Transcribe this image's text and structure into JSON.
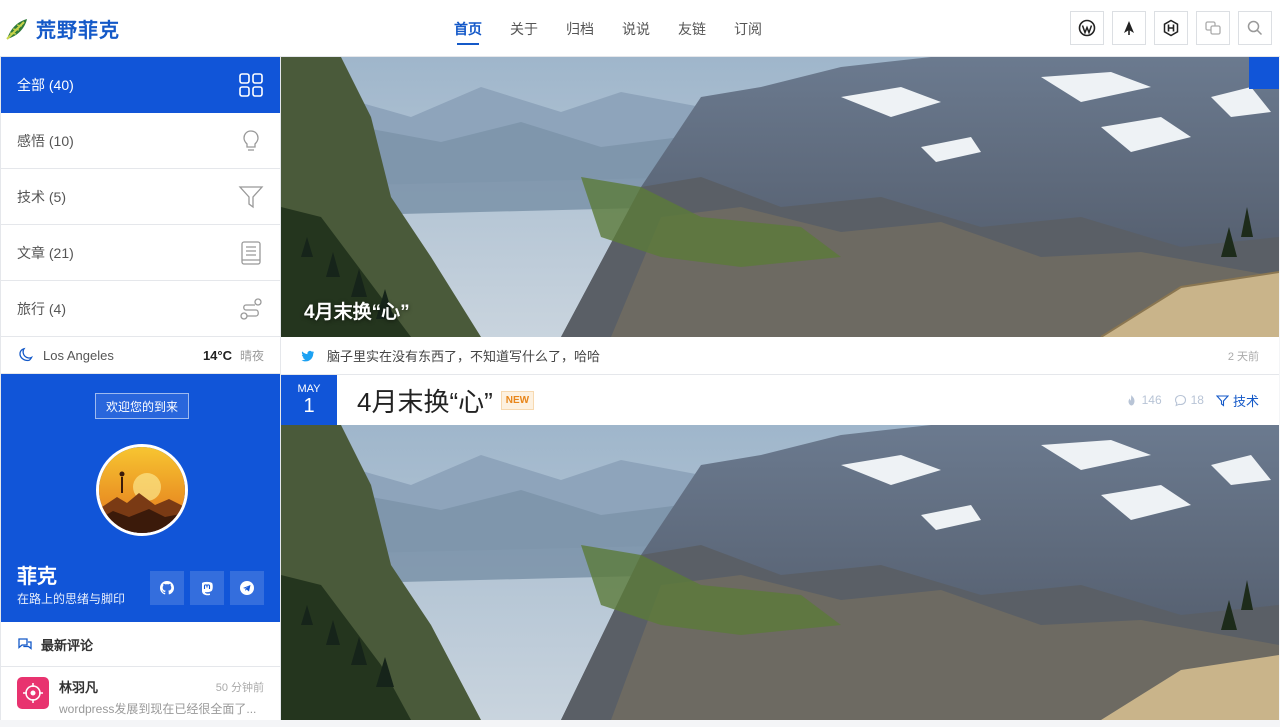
{
  "brand": {
    "name": "荒野菲克"
  },
  "nav": {
    "items": [
      {
        "label": "首页",
        "active": true
      },
      {
        "label": "关于",
        "active": false
      },
      {
        "label": "归档",
        "active": false
      },
      {
        "label": "说说",
        "active": false
      },
      {
        "label": "友链",
        "active": false
      },
      {
        "label": "订阅",
        "active": false
      }
    ]
  },
  "header_icons": [
    "wordpress-icon",
    "feather-icon",
    "hexo-icon",
    "translate-icon",
    "search-icon"
  ],
  "sidebar": {
    "categories": [
      {
        "label": "全部",
        "count": "(40)",
        "icon": "grid-icon",
        "active": true
      },
      {
        "label": "感悟",
        "count": "(10)",
        "icon": "lightbulb-icon",
        "active": false
      },
      {
        "label": "技术",
        "count": "(5)",
        "icon": "filter-icon",
        "active": false
      },
      {
        "label": "文章",
        "count": "(21)",
        "icon": "book-icon",
        "active": false
      },
      {
        "label": "旅行",
        "count": "(4)",
        "icon": "route-icon",
        "active": false
      }
    ],
    "weather": {
      "city": "Los Angeles",
      "temp": "14°C",
      "condition": "晴夜"
    },
    "profile": {
      "welcome": "欢迎您的到来",
      "name": "菲克",
      "description": "在路上的思绪与脚印",
      "socials": [
        "github-icon",
        "mastodon-icon",
        "telegram-icon"
      ]
    },
    "comments": {
      "title": "最新评论",
      "items": [
        {
          "name": "林羽凡",
          "time": "50 分钟前",
          "text": "wordpress发展到现在已经很全面了..."
        }
      ]
    }
  },
  "hero": {
    "title": "4月末换“心”"
  },
  "tweet": {
    "text": "脑子里实在没有东西了，不知道写什么了，哈哈",
    "time": "2 天前"
  },
  "post": {
    "month": "MAY",
    "day": "1",
    "title": "4月末换“心”",
    "badge": "NEW",
    "views": "146",
    "comments": "18",
    "category": "技术"
  },
  "colors": {
    "accent": "#1155d8",
    "brand": "#1459c8",
    "badge": "#e8861a",
    "avatar_bg": "#e8336f"
  }
}
